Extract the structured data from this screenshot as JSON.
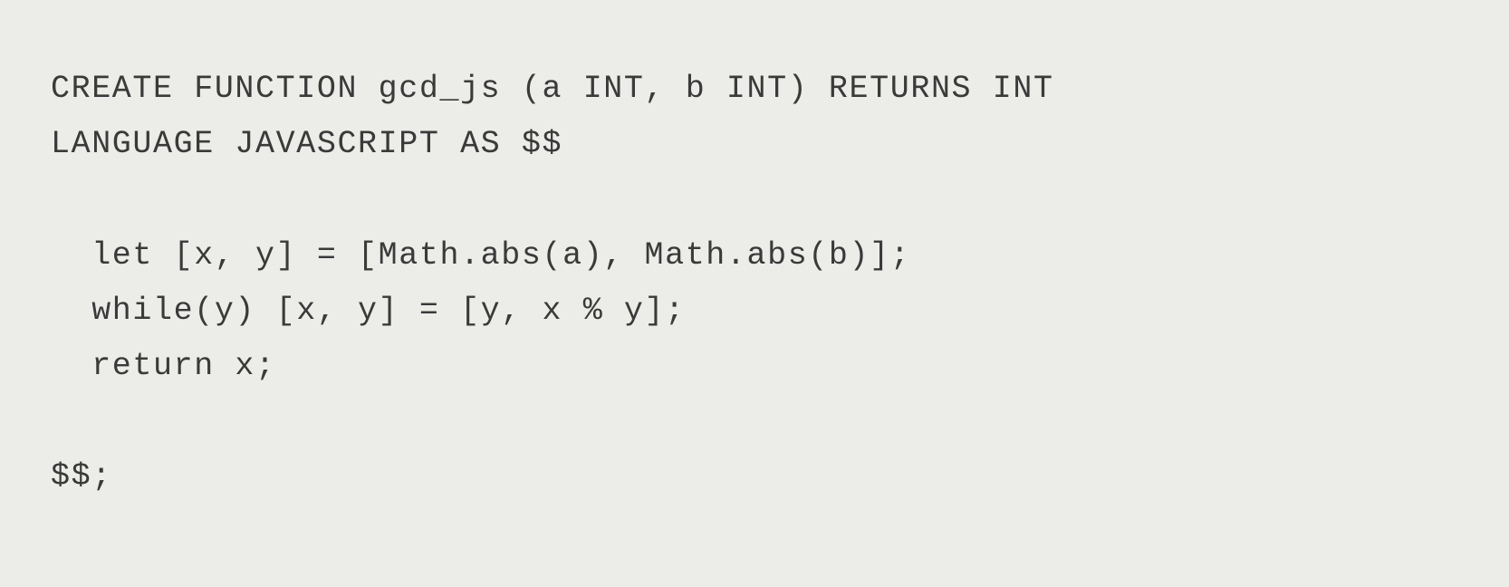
{
  "code": {
    "line1": "CREATE FUNCTION gcd_js (a INT, b INT) RETURNS INT",
    "line2": "LANGUAGE JAVASCRIPT AS $$",
    "line3": "  let [x, y] = [Math.abs(a), Math.abs(b)];",
    "line4": "  while(y) [x, y] = [y, x % y];",
    "line5": "  return x;",
    "line6": "$$;"
  }
}
